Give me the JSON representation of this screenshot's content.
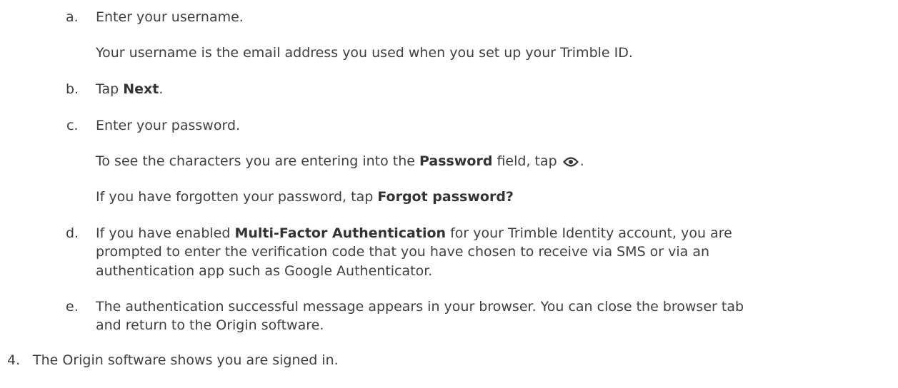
{
  "steps": {
    "a": {
      "marker": "a.",
      "text": "Enter your username.",
      "note": "Your username is the email address you used when you set up your Trimble ID."
    },
    "b": {
      "marker": "b.",
      "pre": "Tap ",
      "bold": "Next",
      "post": "."
    },
    "c": {
      "marker": "c.",
      "text": "Enter your password.",
      "note1_pre": "To see the characters you are entering into the ",
      "note1_bold": "Password",
      "note1_mid": " field, tap ",
      "note1_icon": "eye-icon",
      "note1_post": ".",
      "note2_pre": "If you have forgotten your password, tap ",
      "note2_bold": "Forgot password?"
    },
    "d": {
      "marker": "d.",
      "line1_pre": "If you have enabled ",
      "line1_bold": "Multi-Factor Authentication",
      "line1_post": " for your Trimble Identity account, you are",
      "line2": "prompted to enter the verification code that you have chosen to receive via SMS or via an",
      "line3": "authentication app such as Google Authenticator."
    },
    "e": {
      "marker": "e.",
      "line1": "The authentication successful message appears in your browser. You can close the browser tab",
      "line2": "and return to the Origin software."
    }
  },
  "step4": {
    "marker": "4.",
    "text": "The Origin software shows you are signed in."
  }
}
